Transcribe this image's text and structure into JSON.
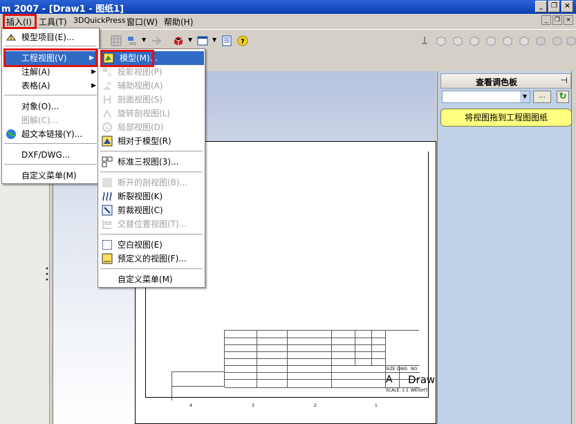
{
  "window": {
    "title": "m 2007 - [Draw1 - 图纸1]"
  },
  "menubar": [
    "插入(I)",
    "工具(T)",
    "3DQuickPress",
    "窗口(W)",
    "帮助(H)"
  ],
  "insert_menu": [
    {
      "label": "模型项目(E)...",
      "icon": "model-items-icon",
      "disabled": false
    },
    {
      "label": "工程视图(V)",
      "submenu": true,
      "selected": true
    },
    {
      "label": "注解(A)",
      "submenu": true
    },
    {
      "label": "表格(A)",
      "submenu": true
    },
    {
      "label": "对象(O)..."
    },
    {
      "label": "图解(C)...",
      "disabled": true
    },
    {
      "label": "超文本链接(Y)...",
      "icon": "globe-icon"
    },
    {
      "label": "DXF/DWG..."
    },
    {
      "label": "自定义菜单(M)"
    }
  ],
  "drawing_view_menu": [
    {
      "label": "模型(M)...",
      "icon": "model-view-icon",
      "selected": true
    },
    {
      "label": "投影视图(P)",
      "icon": "projected-view-icon",
      "disabled": true
    },
    {
      "label": "辅助视图(A)",
      "icon": "auxiliary-view-icon",
      "disabled": true
    },
    {
      "label": "剖面视图(S)",
      "icon": "section-view-icon",
      "disabled": true
    },
    {
      "label": "旋转剖视图(L)",
      "icon": "aligned-section-icon",
      "disabled": true
    },
    {
      "label": "局部视图(D)",
      "icon": "detail-view-icon",
      "disabled": true
    },
    {
      "label": "相对于模型(R)",
      "icon": "relative-view-icon"
    },
    {
      "label": "标准三视图(3)...",
      "icon": "standard-3-view-icon"
    },
    {
      "label": "断开的剖视图(B)...",
      "icon": "broken-out-section-icon",
      "disabled": true
    },
    {
      "label": "断裂视图(K)",
      "icon": "break-view-icon"
    },
    {
      "label": "剪裁视图(C)",
      "icon": "crop-view-icon"
    },
    {
      "label": "交替位置视图(T)...",
      "icon": "alternate-position-icon",
      "disabled": true
    },
    {
      "label": "空白视图(E)",
      "icon": "empty-view-icon"
    },
    {
      "label": "预定义的视图(F)...",
      "icon": "predefined-view-icon"
    },
    {
      "label": "自定义菜单(M)"
    }
  ],
  "task_pane": {
    "title": "查看调色板",
    "dots": "...",
    "message": "将视图拖到工程图图纸"
  },
  "title_block": {
    "sheet_label": "Draw",
    "size_a": "A",
    "size_lbl": "SIZE",
    "dwg_lbl": "DWG",
    "no_lbl": "NO",
    "scale": "SCALE: 1:1",
    "weight": "WEIGHT:",
    "zones": [
      "4",
      "3",
      "2",
      "1"
    ]
  },
  "colors": {
    "highlight": "#316ac5",
    "annotation_red": "#e01010",
    "task_message_bg": "#ffff80"
  }
}
